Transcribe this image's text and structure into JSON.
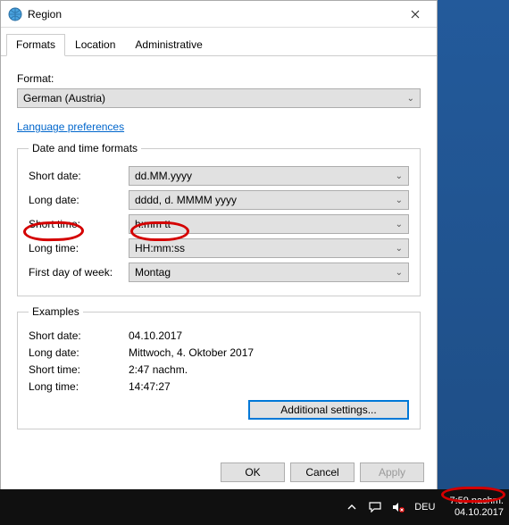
{
  "window": {
    "title": "Region",
    "tabs": [
      "Formats",
      "Location",
      "Administrative"
    ],
    "format_label": "Format:",
    "format_value": "German (Austria)",
    "lang_pref": "Language preferences",
    "group_title": "Date and time formats",
    "rows": {
      "short_date_l": "Short date:",
      "short_date_v": "dd.MM.yyyy",
      "long_date_l": "Long date:",
      "long_date_v": "dddd, d. MMMM yyyy",
      "short_time_l": "Short time:",
      "short_time_v": "h:mm tt",
      "long_time_l": "Long time:",
      "long_time_v": "HH:mm:ss",
      "first_day_l": "First day of week:",
      "first_day_v": "Montag"
    },
    "examples_title": "Examples",
    "ex": {
      "sd_l": "Short date:",
      "sd_v": "04.10.2017",
      "ld_l": "Long date:",
      "ld_v": "Mittwoch, 4. Oktober 2017",
      "st_l": "Short time:",
      "st_v": "2:47 nachm.",
      "lt_l": "Long time:",
      "lt_v": "14:47:27"
    },
    "additional": "Additional settings...",
    "ok": "OK",
    "cancel": "Cancel",
    "apply": "Apply"
  },
  "taskbar": {
    "lang": "DEU",
    "time": "7:59 nachm.",
    "date": "04.10.2017"
  }
}
